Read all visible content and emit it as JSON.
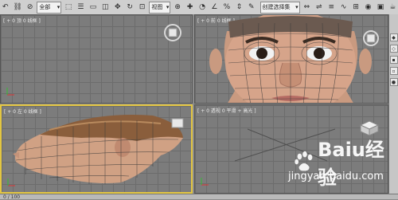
{
  "toolbar": {
    "select_all": "全部",
    "view_dropdown": "视图",
    "selection_set": "创建选择集"
  },
  "viewports": {
    "top_left": {
      "label": "[ + 0 顶 0 线框 ]"
    },
    "top_right": {
      "label": "[ + 0 前 0 线框 ]"
    },
    "bottom_left": {
      "label": "[ + 0 左 0 线框 ]"
    },
    "bottom_right": {
      "label": "[ + 0 透视 0 平滑 + 高光 ]"
    }
  },
  "status": {
    "frame": "0 / 100"
  },
  "watermark": {
    "brand": "Baiu经验",
    "url": "jingyan.baidu.com"
  },
  "colors": {
    "active_border": "#e3c642",
    "viewport_bg": "#7c7c7c"
  }
}
